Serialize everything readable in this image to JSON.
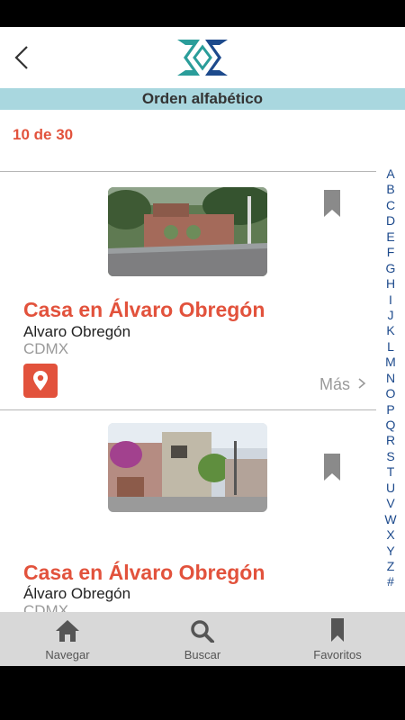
{
  "header": {
    "sort_label": "Orden alfabético"
  },
  "results": {
    "count_text": "10 de 30"
  },
  "listings": [
    {
      "title": "Casa en Álvaro Obregón",
      "subtitle": "Alvaro Obregón",
      "city": "CDMX",
      "more_label": "Más"
    },
    {
      "title": "Casa en Álvaro Obregón",
      "subtitle": "Álvaro Obregón",
      "city": "CDMX"
    }
  ],
  "alphabet": [
    "A",
    "B",
    "C",
    "D",
    "E",
    "F",
    "G",
    "H",
    "I",
    "J",
    "K",
    "L",
    "M",
    "N",
    "O",
    "P",
    "Q",
    "R",
    "S",
    "T",
    "U",
    "V",
    "W",
    "X",
    "Y",
    "Z",
    "#"
  ],
  "tabs": [
    {
      "label": "Navegar",
      "icon": "home-icon"
    },
    {
      "label": "Buscar",
      "icon": "search-icon"
    },
    {
      "label": "Favoritos",
      "icon": "bookmark-icon"
    }
  ],
  "colors": {
    "accent": "#e2523c",
    "sort_bar": "#a9d7df",
    "index_letters": "#1d4a8c",
    "tab_bar": "#d8d8d8"
  }
}
